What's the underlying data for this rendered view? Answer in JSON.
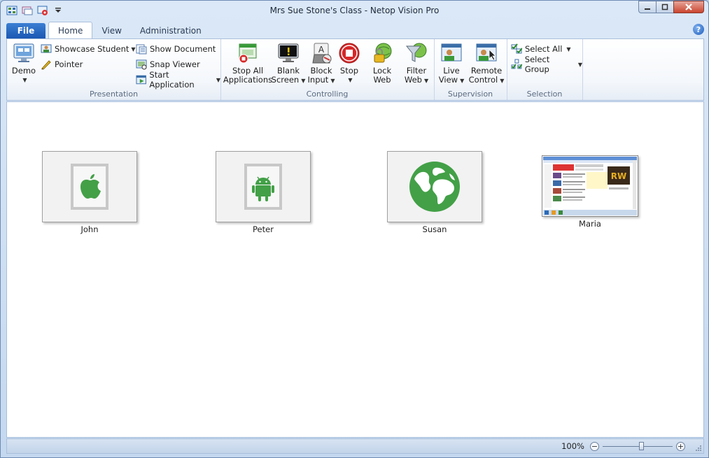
{
  "window": {
    "title": "Mrs Sue Stone's Class - Netop Vision Pro"
  },
  "tabs": [
    {
      "label": "File"
    },
    {
      "label": "Home"
    },
    {
      "label": "View"
    },
    {
      "label": "Administration"
    }
  ],
  "ribbon": {
    "presentation": {
      "label": "Presentation",
      "demo": "Demo",
      "showcase_student": "Showcase Student",
      "pointer": "Pointer",
      "show_document": "Show Document",
      "snap_viewer": "Snap Viewer",
      "start_application": "Start Application"
    },
    "controlling": {
      "label": "Controlling",
      "stop_all_1": "Stop All",
      "stop_all_2": "Applications",
      "blank_1": "Blank",
      "blank_2": "Screen",
      "block_1": "Block",
      "block_2": "Input",
      "stop": "Stop",
      "lock_1": "Lock",
      "lock_2": "Web",
      "filter_1": "Filter",
      "filter_2": "Web"
    },
    "supervision": {
      "label": "Supervision",
      "live_1": "Live",
      "live_2": "View",
      "remote_1": "Remote",
      "remote_2": "Control"
    },
    "selection": {
      "label": "Selection",
      "select_all": "Select All",
      "select_group": "Select Group"
    }
  },
  "students": [
    {
      "name": "John",
      "device": "apple-icon"
    },
    {
      "name": "Peter",
      "device": "android-icon"
    },
    {
      "name": "Susan",
      "device": "globe-icon"
    },
    {
      "name": "Maria",
      "device": "screen-thumbnail"
    }
  ],
  "status": {
    "zoom": "100%",
    "zoom_minus": "−",
    "zoom_plus": "+"
  },
  "colors": {
    "accent": "#1b57b3",
    "device_green": "#43a047"
  }
}
